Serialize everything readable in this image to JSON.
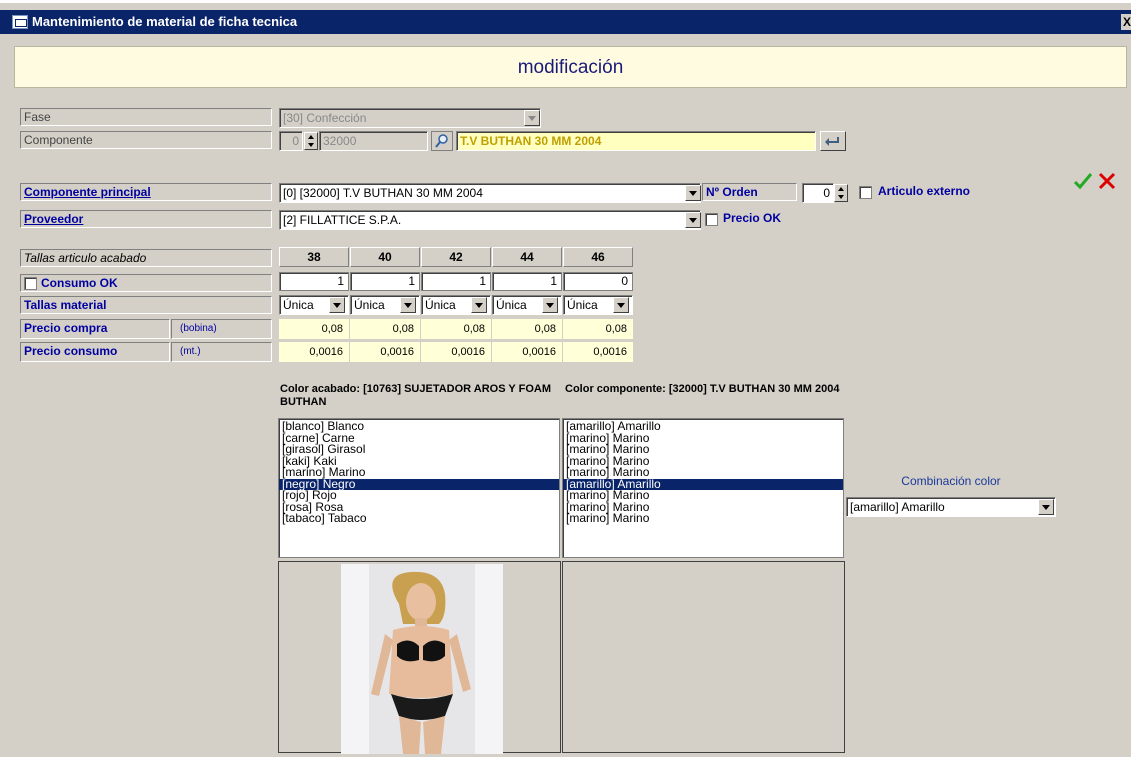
{
  "window": {
    "title": "Mantenimiento de material de ficha tecnica",
    "close_glyph": "X"
  },
  "mode": "modificación",
  "fase": {
    "label": "Fase",
    "value": "[30] Confección"
  },
  "componente": {
    "label": "Componente",
    "num": "0",
    "code": "32000",
    "name": "T.V BUTHAN 30 MM 2004"
  },
  "componente_principal": {
    "label": "Componente principal",
    "value": "[0] [32000] T.V BUTHAN 30 MM 2004"
  },
  "n_orden": {
    "label": "Nº Orden",
    "value": "0"
  },
  "articulo_externo": {
    "label": "Articulo externo"
  },
  "proveedor": {
    "label": "Proveedor",
    "value": "[2] FILLATTICE S.P.A."
  },
  "precio_ok": {
    "label": "Precio OK"
  },
  "tallas": {
    "header_label": "Tallas articulo acabado",
    "sizes": [
      "38",
      "40",
      "42",
      "44",
      "46"
    ],
    "consumo_label": "Consumo OK",
    "consumo": [
      "1",
      "1",
      "1",
      "1",
      "0"
    ],
    "material_label": "Tallas material",
    "material": [
      "Única",
      "Única",
      "Única",
      "Única",
      "Única"
    ],
    "precio_compra_label": "Precio compra",
    "precio_compra_unit": "(bobina)",
    "precio_compra": [
      "0,08",
      "0,08",
      "0,08",
      "0,08",
      "0,08"
    ],
    "precio_consumo_label": "Precio consumo",
    "precio_consumo_unit": "(mt.)",
    "precio_consumo": [
      "0,0016",
      "0,0016",
      "0,0016",
      "0,0016",
      "0,0016"
    ]
  },
  "color_acabado": {
    "header": "Color acabado: [10763] SUJETADOR AROS Y FOAM BUTHAN",
    "items": [
      "[blanco] Blanco",
      "[carne] Carne",
      "[girasol] Girasol",
      "[kaki] Kaki",
      "[marino] Marino",
      "[negro] Negro",
      "[rojo] Rojo",
      "[rosa] Rosa",
      "[tabaco] Tabaco"
    ],
    "selected_index": 5
  },
  "color_componente": {
    "header": "Color componente: [32000] T.V BUTHAN 30 MM 2004",
    "items": [
      "[amarillo] Amarillo",
      "[marino] Marino",
      "[marino] Marino",
      "[marino] Marino",
      "[marino] Marino",
      "[amarillo] Amarillo",
      "[marino] Marino",
      "[marino] Marino",
      "[marino] Marino"
    ],
    "selected_index": 5
  },
  "combinacion": {
    "label": "Combinación color",
    "value": "[amarillo] Amarillo"
  },
  "colors": {
    "title_bar": "#0a246a",
    "header_band": "#fffbe0",
    "link": "#0000a0",
    "accept": "#22aa22",
    "cancel": "#dd0000"
  },
  "icons": [
    "search-icon",
    "enter-arrow-icon",
    "checkmark-icon",
    "cross-icon",
    "spin-icon",
    "dropdown-icon"
  ]
}
